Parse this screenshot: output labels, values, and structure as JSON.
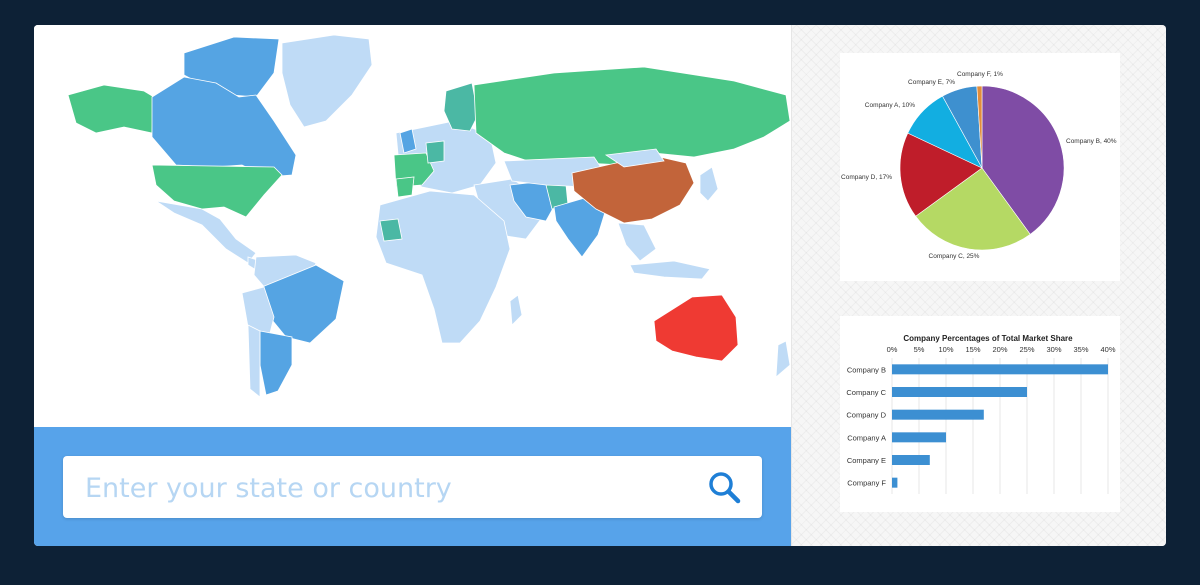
{
  "search": {
    "placeholder": "Enter your state or country",
    "icon": "search-icon"
  },
  "map": {
    "colors": {
      "ocean": "#ffffff",
      "default": "#bfdbf6",
      "blue": "#55a4e3",
      "green": "#4ac687",
      "teal": "#4bb8a4",
      "brown": "#c2643a",
      "red": "#ef3a33",
      "border": "#ffffff"
    }
  },
  "chart_data": [
    {
      "type": "pie",
      "series": [
        {
          "name": "Company B",
          "value": 40,
          "label": "Company B, 40%",
          "color": "#7f4ca5"
        },
        {
          "name": "Company C",
          "value": 25,
          "label": "Company C, 25%",
          "color": "#b5d964"
        },
        {
          "name": "Company D",
          "value": 17,
          "label": "Company D, 17%",
          "color": "#bf1d2a"
        },
        {
          "name": "Company A",
          "value": 10,
          "label": "Company A, 10%",
          "color": "#12aee1"
        },
        {
          "name": "Company E",
          "value": 7,
          "label": "Company E, 7%",
          "color": "#3e90cf"
        },
        {
          "name": "Company F",
          "value": 1,
          "label": "Company F, 1%",
          "color": "#e18d3b"
        }
      ]
    },
    {
      "type": "bar",
      "orientation": "horizontal",
      "title": "Company Percentages  of Total Market Share",
      "categories": [
        "Company B",
        "Company C",
        "Company D",
        "Company A",
        "Company E",
        "Company F"
      ],
      "values": [
        40,
        25,
        17,
        10,
        7,
        1
      ],
      "xticks": [
        "0%",
        "5%",
        "10%",
        "15%",
        "20%",
        "25%",
        "30%",
        "35%",
        "40%"
      ],
      "xlim": [
        0,
        40
      ],
      "bar_color": "#3c8fd2",
      "grid": true
    }
  ]
}
